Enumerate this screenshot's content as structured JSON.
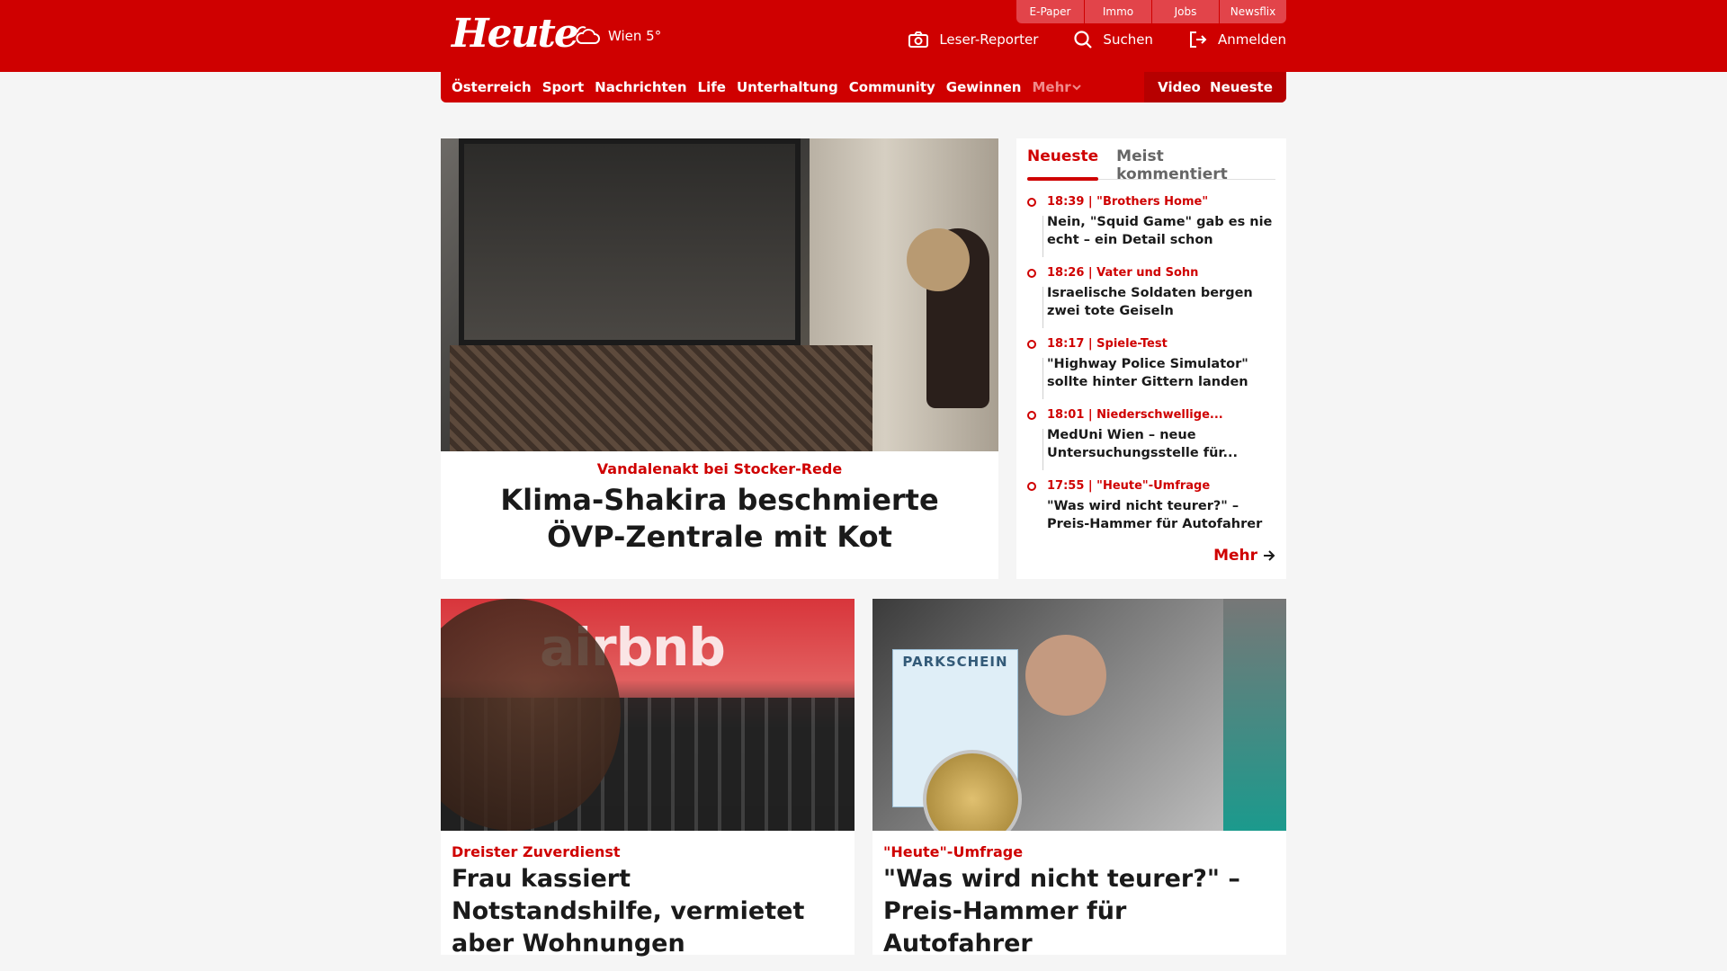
{
  "header": {
    "top_links": [
      "E-Paper",
      "Immo",
      "Jobs",
      "Newsflix"
    ],
    "logo": "Heute",
    "weather": "Wien 5°",
    "actions": {
      "reporter": "Leser-Reporter",
      "search": "Suchen",
      "login": "Anmelden"
    }
  },
  "nav": {
    "items": [
      "Österreich",
      "Sport",
      "Nachrichten",
      "Life",
      "Unterhaltung",
      "Community",
      "Gewinnen"
    ],
    "more": "Mehr",
    "video": "Video",
    "latest": "Neueste"
  },
  "feature": {
    "kicker": "Vandalenakt bei Stocker-Rede",
    "title": "Klima-Shakira beschmierte ÖVP-Zentrale mit Kot"
  },
  "sidebar": {
    "tabs": [
      "Neueste",
      "Meist kommentiert"
    ],
    "items": [
      {
        "meta": "18:39 | \"Brothers Home\"",
        "headline": "Nein, \"Squid Game\" gab es nie echt – ein Detail schon"
      },
      {
        "meta": "18:26 | Vater und Sohn",
        "headline": "Israelische Soldaten bergen zwei tote Geiseln"
      },
      {
        "meta": "18:17 | Spiele-Test",
        "headline": "\"Highway Police Simulator\" sollte hinter Gittern landen"
      },
      {
        "meta": "18:01 | Niederschwellige...",
        "headline": "MedUni Wien – neue Untersuchungsstelle für..."
      },
      {
        "meta": "17:55 | \"Heute\"-Umfrage",
        "headline": "\"Was wird nicht teurer?\" – Preis-Hammer für Autofahrer"
      }
    ],
    "more": "Mehr"
  },
  "cards": [
    {
      "kicker": "Dreister Zuverdienst",
      "title": "Frau kassiert Notstandshilfe, vermietet aber Wohnungen",
      "image_text": "airbnb"
    },
    {
      "kicker": "\"Heute\"-Umfrage",
      "title": "\"Was wird nicht teurer?\" – Preis-Hammer für Autofahrer",
      "image_text": "PARKSCHEIN"
    }
  ],
  "colors": {
    "brand": "#cf0000",
    "background": "#f5f5f5"
  }
}
